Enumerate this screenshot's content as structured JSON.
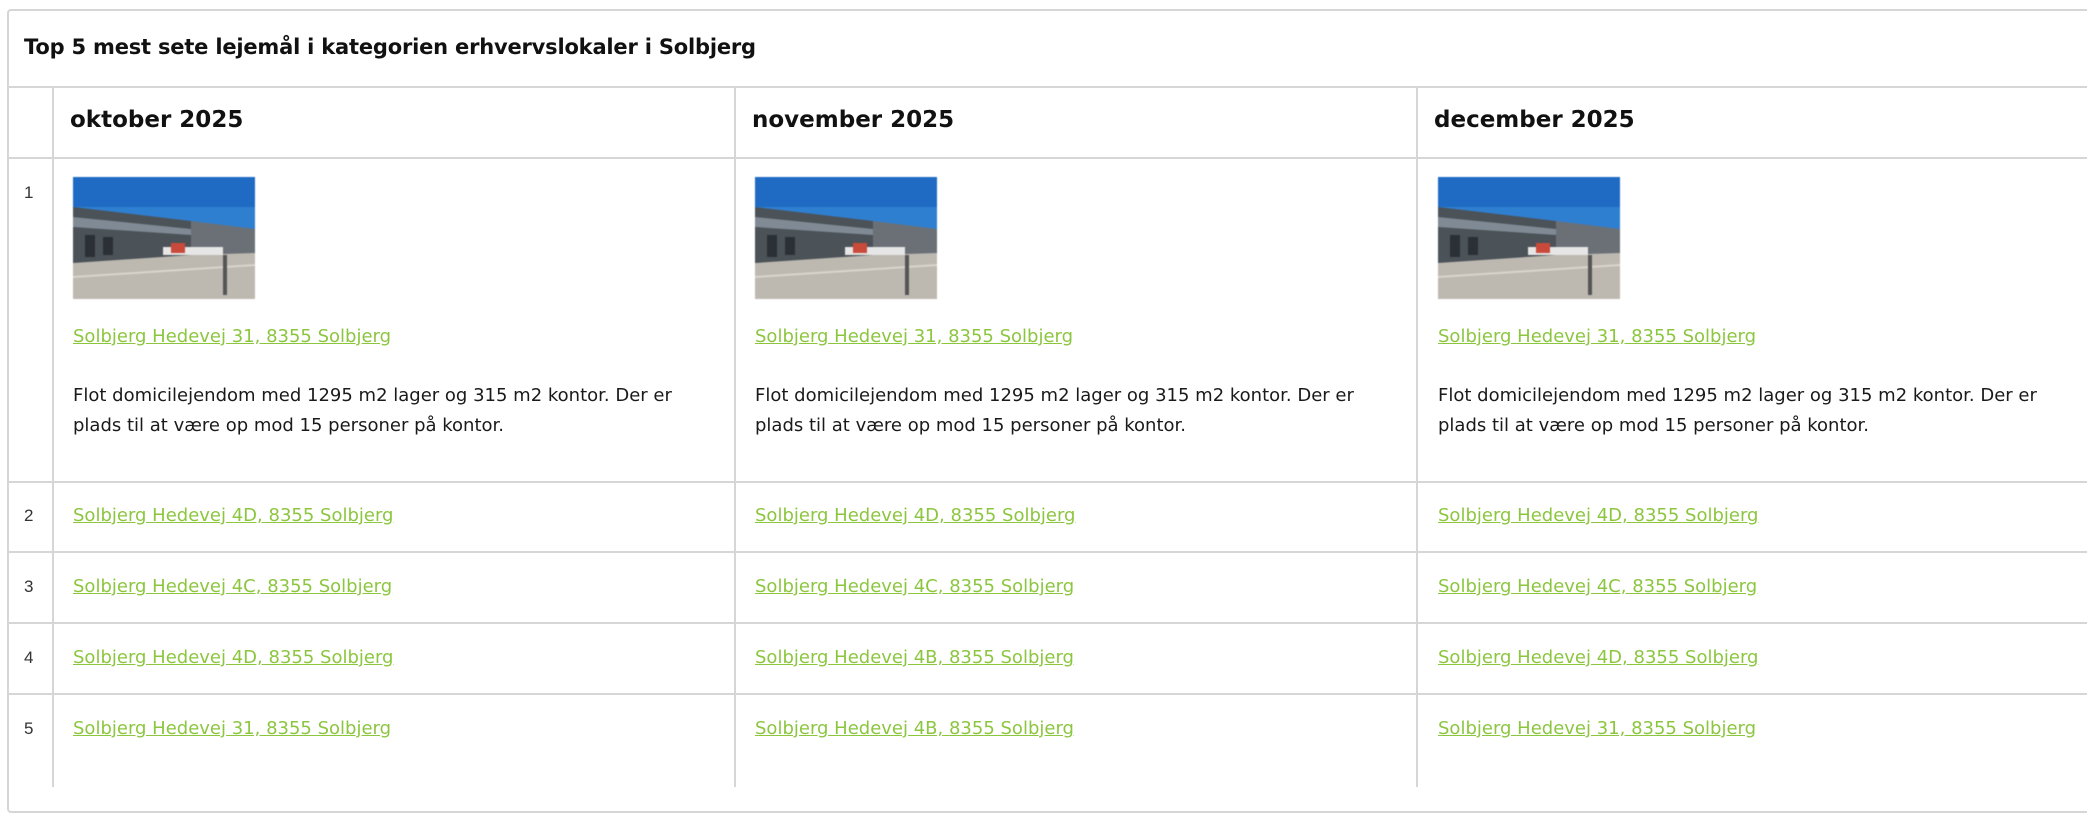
{
  "title": "Top 5 mest sete lejemål i kategorien erhvervslokaler i Solbjerg",
  "columns": [
    {
      "month": "oktober 2025",
      "rows": [
        "Solbjerg Hedevej 31, 8355 Solbjerg",
        "Solbjerg Hedevej 4D, 8355 Solbjerg",
        "Solbjerg Hedevej 4C, 8355 Solbjerg",
        "Solbjerg Hedevej 4D, 8355 Solbjerg",
        "Solbjerg Hedevej 31, 8355 Solbjerg"
      ],
      "description": "Flot domicilejendom med 1295 m2 lager og 315 m2 kontor. Der er plads til at være op mod 15 personer på kontor."
    },
    {
      "month": "november 2025",
      "rows": [
        "Solbjerg Hedevej 31, 8355 Solbjerg",
        "Solbjerg Hedevej 4D, 8355 Solbjerg",
        "Solbjerg Hedevej 4C, 8355 Solbjerg",
        "Solbjerg Hedevej 4B, 8355 Solbjerg",
        "Solbjerg Hedevej 4B, 8355 Solbjerg"
      ],
      "description": "Flot domicilejendom med 1295 m2 lager og 315 m2 kontor. Der er plads til at være op mod 15 personer på kontor."
    },
    {
      "month": "december 2025",
      "rows": [
        "Solbjerg Hedevej 31, 8355 Solbjerg",
        "Solbjerg Hedevej 4D, 8355 Solbjerg",
        "Solbjerg Hedevej 4C, 8355 Solbjerg",
        "Solbjerg Hedevej 4D, 8355 Solbjerg",
        "Solbjerg Hedevej 31, 8355 Solbjerg"
      ],
      "description": "Flot domicilejendom med 1295 m2 lager og 315 m2 kontor. Der er plads til at være op mod 15 personer på kontor."
    }
  ],
  "row_numbers": [
    "1",
    "2",
    "3",
    "4",
    "5"
  ],
  "colors": {
    "link": "#8cc63f",
    "border": "#d6d6d6",
    "text": "#1a1a1a"
  }
}
